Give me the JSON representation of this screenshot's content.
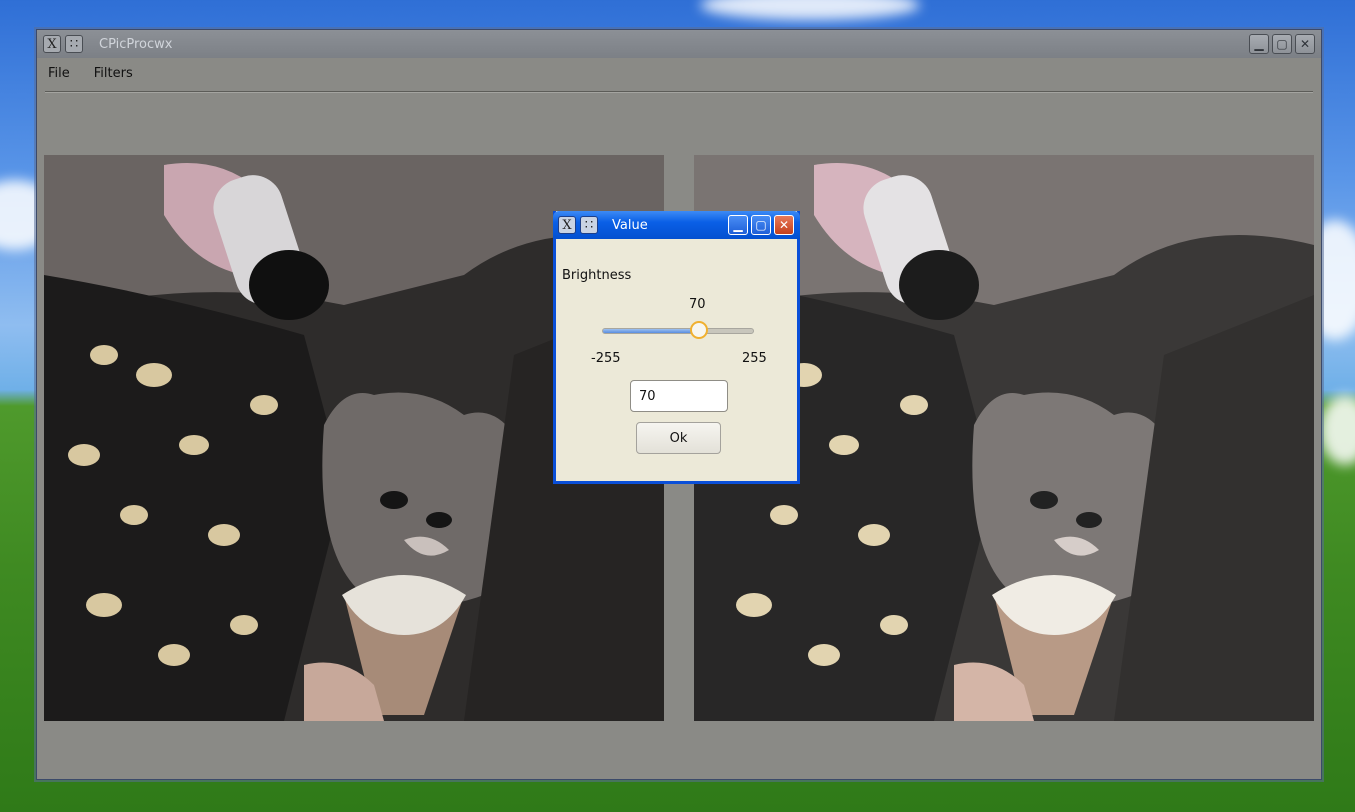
{
  "main_window": {
    "title": "CPicProcwx",
    "menu": [
      "File",
      "Filters"
    ],
    "title_icon": "x-window-icon",
    "menu_icon": "window-menu-icon",
    "buttons": [
      "minimize-icon",
      "maximize-icon",
      "close-icon"
    ]
  },
  "panels": {
    "left": {
      "content": "cat-eating-ice-cream-original"
    },
    "right": {
      "content": "cat-eating-ice-cream-brightened"
    }
  },
  "dialog": {
    "title": "Value",
    "label": "Brightness",
    "slider": {
      "value": "70",
      "min": "-255",
      "max": "255",
      "fraction": 0.637
    },
    "input_value": "70",
    "ok_label": "Ok"
  },
  "colors": {
    "dialog_accent": "#0a4fd8",
    "slider_thumb_border": "#f0b030",
    "window_bg": "#8a8a86"
  }
}
